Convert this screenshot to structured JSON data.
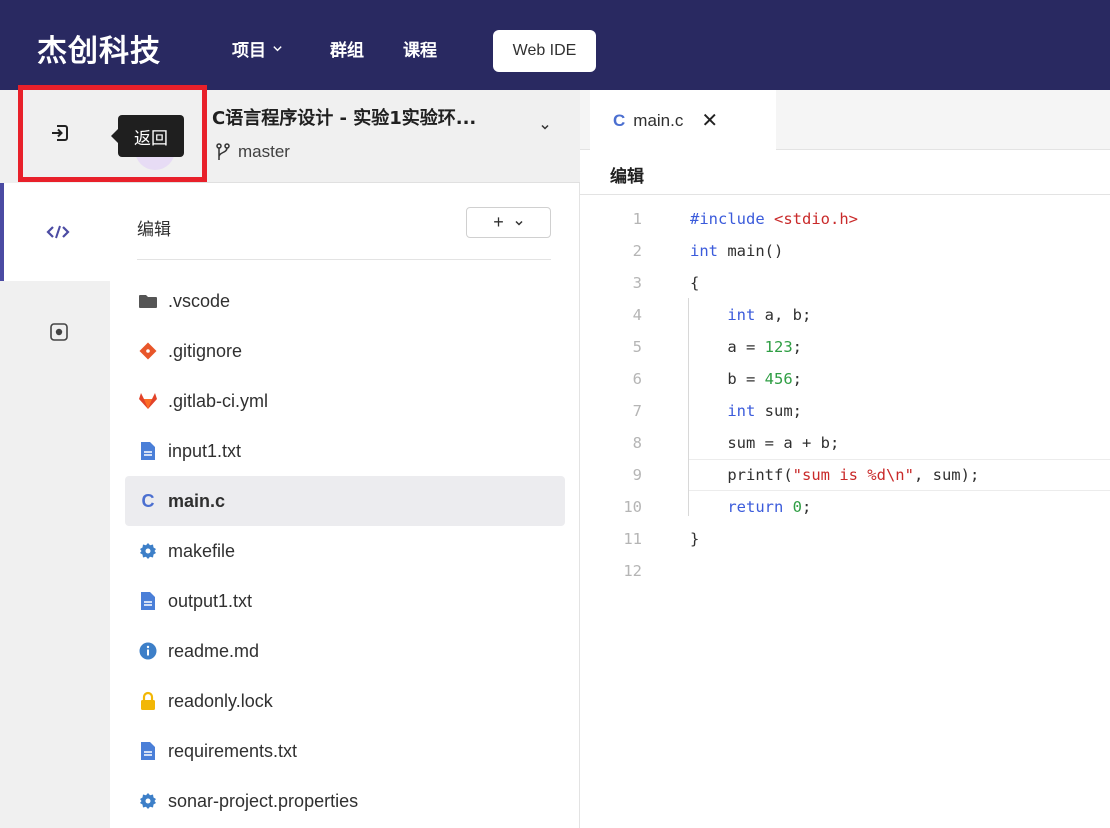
{
  "topbar": {
    "brand": "杰创科技",
    "nav": [
      "项目",
      "群组",
      "课程"
    ],
    "webide_label": "Web IDE"
  },
  "tooltip": {
    "text": "返回"
  },
  "project": {
    "title": "C语言程序设计 - 实验1实验环...",
    "branch": "master"
  },
  "explorer": {
    "title": "编辑",
    "add_label": "+",
    "files": [
      {
        "name": ".vscode",
        "icon": "folder-icon"
      },
      {
        "name": ".gitignore",
        "icon": "git-icon"
      },
      {
        "name": ".gitlab-ci.yml",
        "icon": "gitlab-icon"
      },
      {
        "name": "input1.txt",
        "icon": "file-text-icon"
      },
      {
        "name": "main.c",
        "icon": "c-file-icon",
        "active": true
      },
      {
        "name": "makefile",
        "icon": "gear-icon"
      },
      {
        "name": "output1.txt",
        "icon": "file-text-icon"
      },
      {
        "name": "readme.md",
        "icon": "info-icon"
      },
      {
        "name": "readonly.lock",
        "icon": "lock-icon"
      },
      {
        "name": "requirements.txt",
        "icon": "file-text-icon"
      },
      {
        "name": "sonar-project.properties",
        "icon": "gear-icon"
      }
    ]
  },
  "editor": {
    "tab_label": "main.c",
    "tab_icon": "C",
    "mode_label": "编辑",
    "lines": [
      "#include <stdio.h>",
      "int main()",
      "{",
      "    int a, b;",
      "    a = 123;",
      "    b = 456;",
      "    int sum;",
      "    sum = a + b;",
      "    printf(\"sum is %d\\n\", sum);",
      "    return 0;",
      "}",
      ""
    ]
  },
  "colors": {
    "topbar": "#292961",
    "accent": "#4b4ba3",
    "highlight_box": "#e8202a",
    "keyword": "#3b5bdb",
    "string": "#c92a2a",
    "number": "#2f9e44"
  }
}
